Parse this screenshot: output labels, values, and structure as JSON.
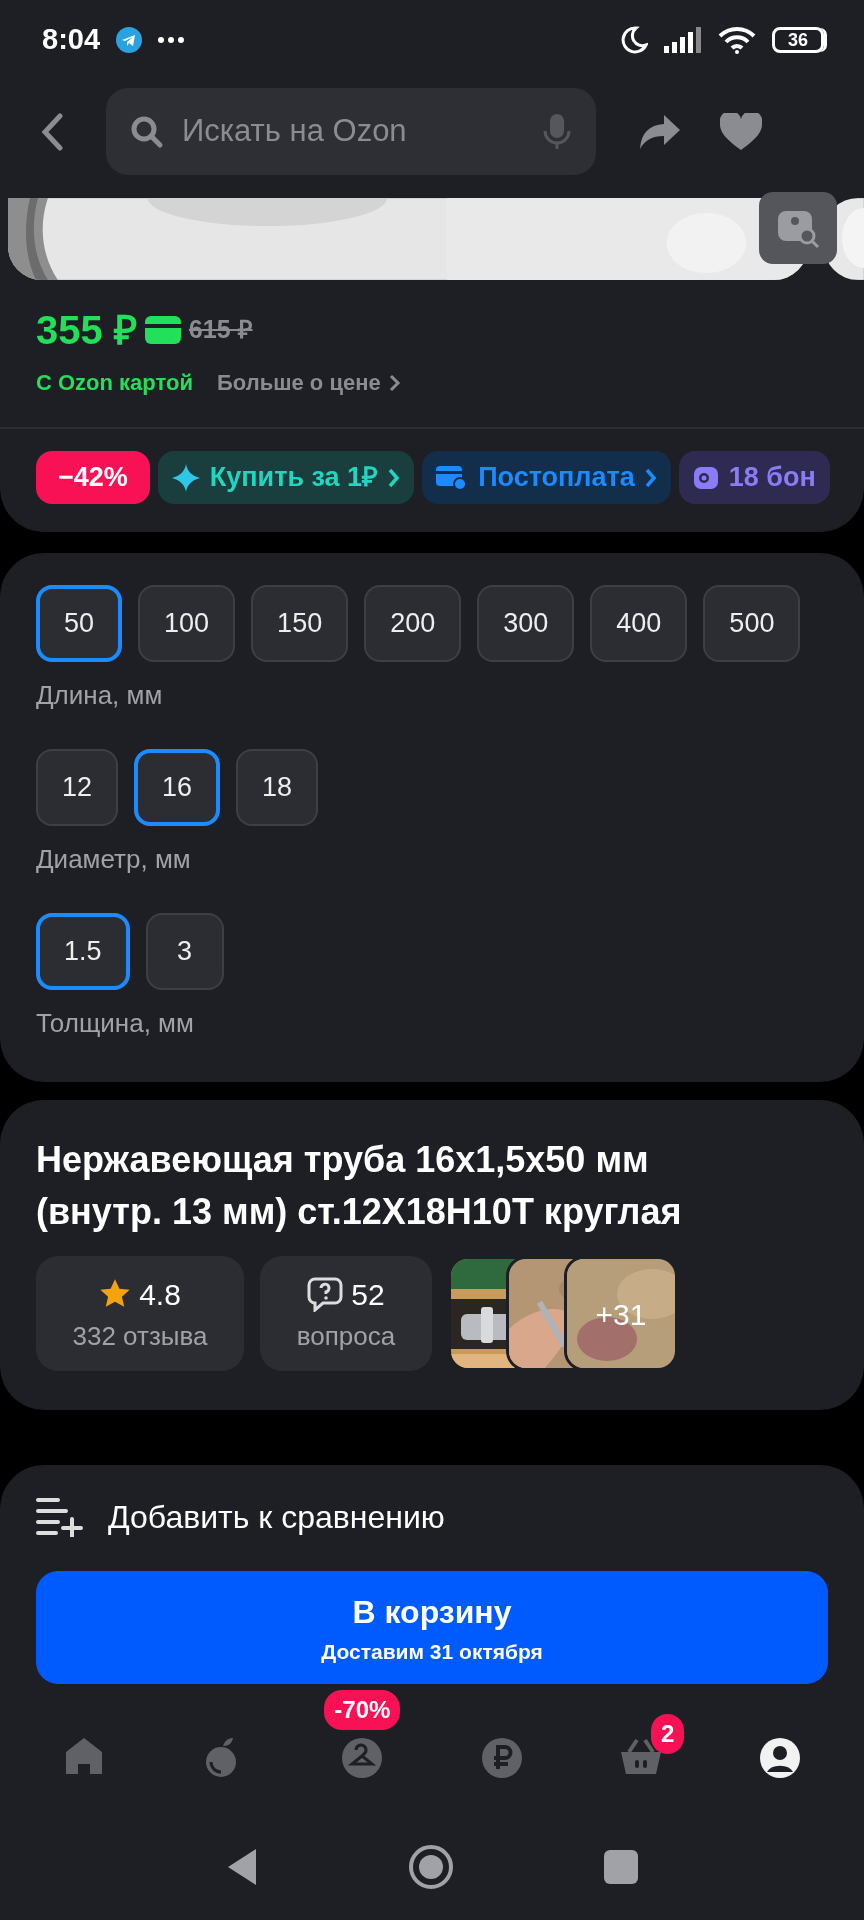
{
  "status_bar": {
    "time": "8:04",
    "battery": "36"
  },
  "search": {
    "placeholder": "Искать на Ozon"
  },
  "price": {
    "current": "355 ₽",
    "old": "615 ₽",
    "card_label": "С Ozon картой",
    "more": "Больше о цене"
  },
  "chips": [
    {
      "kind": "discount",
      "label": "−42%"
    },
    {
      "kind": "promo",
      "label": "Купить за 1₽"
    },
    {
      "kind": "postpay",
      "label": "Постоплата"
    },
    {
      "kind": "bonus",
      "label": "18 бон"
    }
  ],
  "options": [
    {
      "label": "Длина, мм",
      "values": [
        {
          "label": "50",
          "selected": true
        },
        {
          "label": "100",
          "selected": false
        },
        {
          "label": "150",
          "selected": false
        },
        {
          "label": "200",
          "selected": false
        },
        {
          "label": "300",
          "selected": false
        },
        {
          "label": "400",
          "selected": false
        },
        {
          "label": "500",
          "selected": false
        }
      ]
    },
    {
      "label": "Диаметр, мм",
      "values": [
        {
          "label": "12",
          "selected": false
        },
        {
          "label": "16",
          "selected": true
        },
        {
          "label": "18",
          "selected": false
        }
      ]
    },
    {
      "label": "Толщина, мм",
      "values": [
        {
          "label": "1.5",
          "selected": true
        },
        {
          "label": "3",
          "selected": false
        }
      ]
    }
  ],
  "title": "Нержавеющая труба 16x1,5x50 мм (внутр. 13 мм) ст.12Х18Н10Т круглая",
  "rating": {
    "value": "4.8",
    "reviews": "332 отзыва"
  },
  "questions": {
    "count": "52",
    "label": "вопроса"
  },
  "photos": {
    "more": "+31"
  },
  "compare": "Добавить к сравнению",
  "cart_button": {
    "label": "В корзину",
    "delivery": "Доставим 31 октября"
  },
  "nav": [
    {
      "kind": "home",
      "selected": false
    },
    {
      "kind": "fresh",
      "selected": false
    },
    {
      "kind": "fashion",
      "selected": false,
      "badge": "-70%"
    },
    {
      "kind": "finance",
      "selected": false
    },
    {
      "kind": "cart",
      "selected": false,
      "badge": "2"
    },
    {
      "kind": "profile",
      "selected": true
    }
  ]
}
